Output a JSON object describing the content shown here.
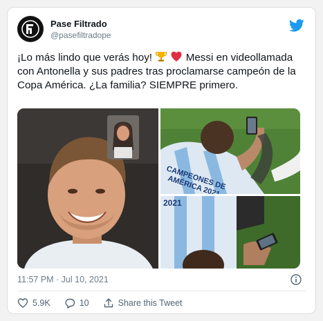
{
  "account": {
    "name": "Pase Filtrado",
    "handle": "@pasefiltradope"
  },
  "tweet": {
    "text_part1": "¡Lo más lindo que verás hoy! ",
    "text_part2": " Messi en videollamada con Antonella y sus padres tras proclamarse campeón de la Copa América. ¿La familia? SIEMPRE primero.",
    "emoji_1": "trophy-icon",
    "emoji_2": "red-heart-icon"
  },
  "media": {
    "jersey_text_top": "CAMPEONES DE AMÉRICA 2021",
    "jersey_text_bottom": "2021"
  },
  "meta": {
    "timestamp": "11:57 PM · Jul 10, 2021"
  },
  "actions": {
    "likes": "5.9K",
    "replies": "10",
    "share_label": "Share this Tweet"
  },
  "colors": {
    "twitter_blue": "#1d9bf0",
    "heart_red": "#e0245e",
    "text_secondary": "#536471"
  }
}
